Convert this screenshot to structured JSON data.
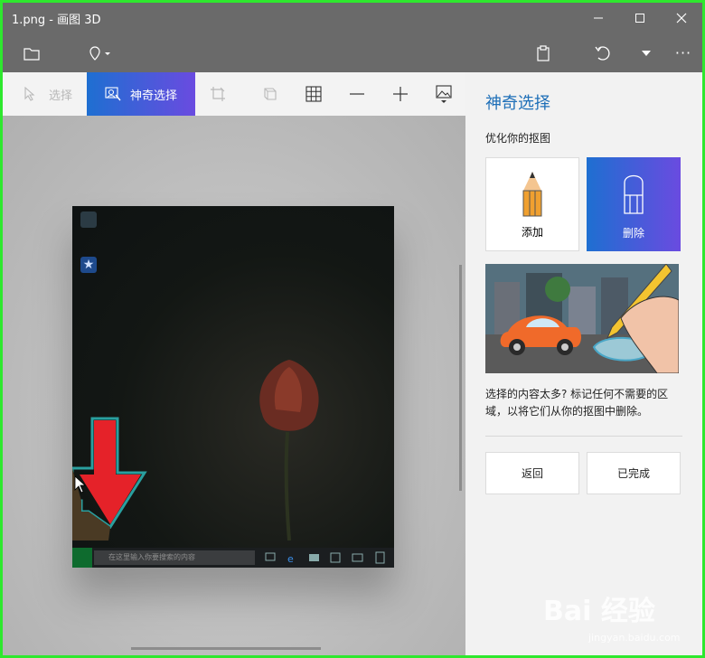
{
  "window": {
    "title": "1.png - 画图 3D",
    "controls": [
      "minimize",
      "maximize",
      "close"
    ]
  },
  "toolbar": {
    "left_icons": [
      "folder-icon",
      "sticker-icon"
    ],
    "right_icons": [
      "paste-icon",
      "undo-icon",
      "dropdown-icon",
      "more-icon"
    ],
    "more_label": "···"
  },
  "ribbon": {
    "items": [
      {
        "label": "选择",
        "icon": "pointer-icon",
        "state": "disabled"
      },
      {
        "label": "神奇选择",
        "icon": "magic-select-icon",
        "state": "active"
      },
      {
        "label": "",
        "icon": "crop-icon",
        "state": "disabled"
      },
      {
        "label": "",
        "icon": "3d-select-icon",
        "state": "disabled"
      },
      {
        "label": "",
        "icon": "grid-icon",
        "state": "normal"
      },
      {
        "label": "",
        "icon": "zoom-out-icon",
        "state": "normal"
      },
      {
        "label": "",
        "icon": "zoom-in-icon",
        "state": "normal"
      },
      {
        "label": "",
        "icon": "image-icon",
        "state": "normal"
      }
    ]
  },
  "image": {
    "taskbar_search_placeholder": "在这里输入你要搜索的内容",
    "arrow_color": "#e52229"
  },
  "panel": {
    "title": "神奇选择",
    "subtitle": "优化你的抠图",
    "add_label": "添加",
    "remove_label": "删除",
    "description": "选择的内容太多? 标记任何不需要的区域，以将它们从你的抠图中删除。",
    "back_label": "返回",
    "done_label": "已完成"
  },
  "colors": {
    "accent": "#1e6fd1",
    "accent_gradient_end": "#6a4be0",
    "window_border": "#2ee82e",
    "titlebar": "#6a6a6a"
  },
  "watermark": {
    "text": "Bai 经验",
    "sub": "jingyan.baidu.com"
  }
}
